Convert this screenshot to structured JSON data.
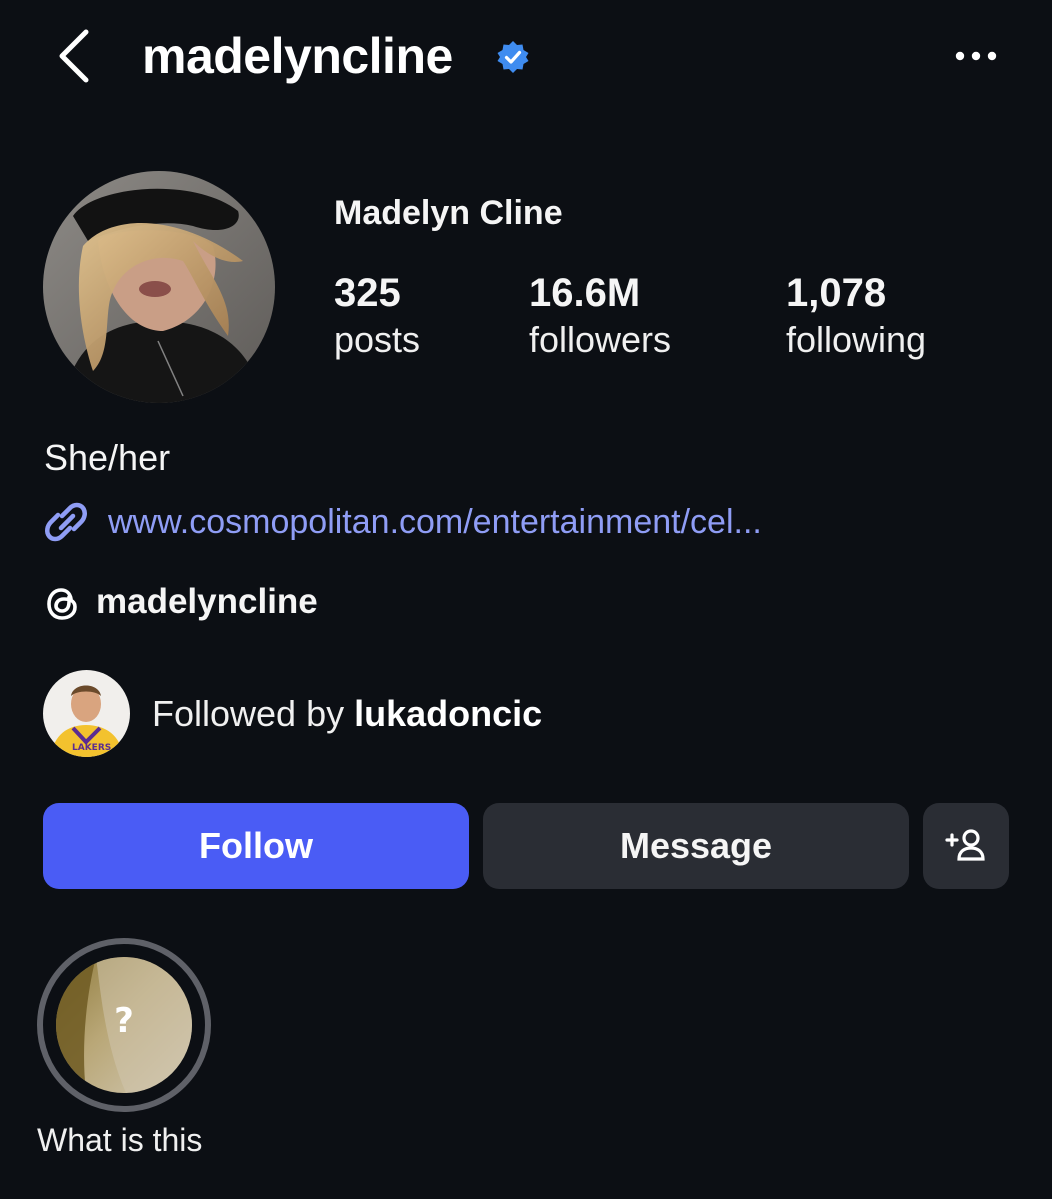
{
  "header": {
    "username": "madelyncline",
    "verified": true,
    "back_icon": "chevron-left-icon",
    "more_icon": "ellipsis-icon"
  },
  "profile": {
    "display_name": "Madelyn Cline",
    "stats": [
      {
        "value": "325",
        "label": "posts"
      },
      {
        "value": "16.6M",
        "label": "followers"
      },
      {
        "value": "1,078",
        "label": "following"
      }
    ],
    "pronouns": "She/her",
    "link": "www.cosmopolitan.com/entertainment/cel...",
    "threads_handle": "madelyncline",
    "followed_by_prefix": "Followed by ",
    "followed_by_user": "lukadoncic"
  },
  "actions": {
    "follow_label": "Follow",
    "message_label": "Message",
    "add_icon": "add-person-icon"
  },
  "highlights": [
    {
      "label": "What is this",
      "glyph": "?"
    }
  ],
  "colors": {
    "background": "#0c0f14",
    "follow_button": "#4a5cf5",
    "secondary_button": "#2a2d34",
    "link": "#8f9df5",
    "verified_badge": "#3f8cf0"
  }
}
